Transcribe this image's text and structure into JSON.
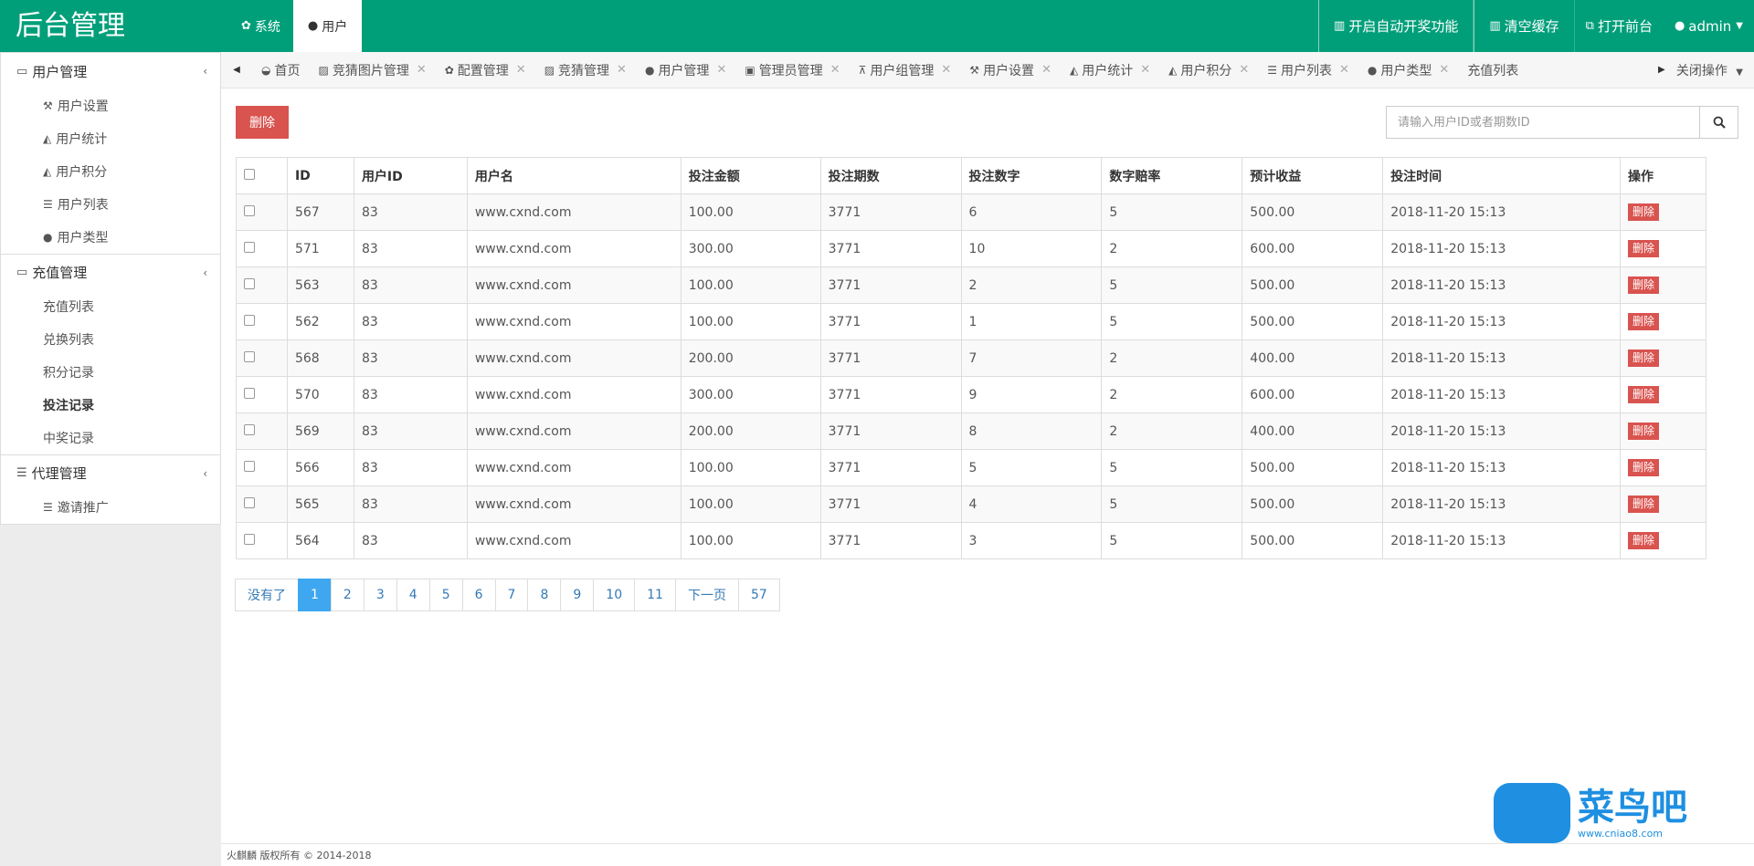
{
  "header": {
    "brand": "后台管理",
    "nav": [
      {
        "icon": "gear-icon",
        "glyph": "✿",
        "label": "系统"
      },
      {
        "icon": "user-icon",
        "glyph": "●",
        "label": "用户"
      }
    ],
    "actions": [
      {
        "icon": "trash-icon",
        "glyph": "▥",
        "label": "开启自动开奖功能"
      },
      {
        "icon": "trash-icon",
        "glyph": "▥",
        "label": "清空缓存"
      }
    ],
    "open_frontend": "打开前台",
    "user": "admin"
  },
  "sidebar": {
    "sections": [
      {
        "title": "用户管理",
        "items": [
          {
            "icon": "wrench-icon",
            "glyph": "⚒",
            "label": "用户设置"
          },
          {
            "icon": "area-chart-icon",
            "glyph": "◭",
            "label": "用户统计"
          },
          {
            "icon": "area-chart-icon",
            "glyph": "◭",
            "label": "用户积分"
          },
          {
            "icon": "list-icon",
            "glyph": "☰",
            "label": "用户列表"
          },
          {
            "icon": "user-icon",
            "glyph": "●",
            "label": "用户类型"
          }
        ]
      },
      {
        "title": "充值管理",
        "items": [
          {
            "label": "充值列表"
          },
          {
            "label": "兑换列表"
          },
          {
            "label": "积分记录"
          },
          {
            "label": "投注记录"
          },
          {
            "label": "中奖记录"
          }
        ]
      },
      {
        "title": "代理管理",
        "items": [
          {
            "icon": "list-icon",
            "glyph": "☰",
            "label": "邀请推广"
          }
        ]
      }
    ]
  },
  "tabs": [
    {
      "icon": "dashboard-icon",
      "glyph": "◒",
      "label": "首页"
    },
    {
      "icon": "image-icon",
      "glyph": "▨",
      "label": "竞猜图片管理"
    },
    {
      "icon": "cogs-icon",
      "glyph": "✿",
      "label": "配置管理"
    },
    {
      "icon": "image-icon",
      "glyph": "▨",
      "label": "竞猜管理"
    },
    {
      "icon": "user-icon",
      "glyph": "●",
      "label": "用户管理"
    },
    {
      "icon": "lock-icon",
      "glyph": "▣",
      "label": "管理员管理"
    },
    {
      "icon": "sitemap-icon",
      "glyph": "⊼",
      "label": "用户组管理"
    },
    {
      "icon": "wrench-icon",
      "glyph": "⚒",
      "label": "用户设置"
    },
    {
      "icon": "area-chart-icon",
      "glyph": "◭",
      "label": "用户统计"
    },
    {
      "icon": "area-chart-icon",
      "glyph": "◭",
      "label": "用户积分"
    },
    {
      "icon": "list-icon",
      "glyph": "☰",
      "label": "用户列表"
    },
    {
      "icon": "user-icon",
      "glyph": "●",
      "label": "用户类型"
    },
    {
      "label": "充值列表"
    }
  ],
  "tab_close_ops": "关闭操作",
  "content": {
    "delete_label": "删除",
    "search_placeholder": "请输入用户ID或者期数ID",
    "columns": [
      "ID",
      "用户ID",
      "用户名",
      "投注金额",
      "投注期数",
      "投注数字",
      "数字赔率",
      "预计收益",
      "投注时间",
      "操作"
    ],
    "row_action": "删除",
    "rows": [
      [
        "567",
        "83",
        "www.cxnd.com",
        "100.00",
        "3771",
        "6",
        "5",
        "500.00",
        "2018-11-20 15:13"
      ],
      [
        "571",
        "83",
        "www.cxnd.com",
        "300.00",
        "3771",
        "10",
        "2",
        "600.00",
        "2018-11-20 15:13"
      ],
      [
        "563",
        "83",
        "www.cxnd.com",
        "100.00",
        "3771",
        "2",
        "5",
        "500.00",
        "2018-11-20 15:13"
      ],
      [
        "562",
        "83",
        "www.cxnd.com",
        "100.00",
        "3771",
        "1",
        "5",
        "500.00",
        "2018-11-20 15:13"
      ],
      [
        "568",
        "83",
        "www.cxnd.com",
        "200.00",
        "3771",
        "7",
        "2",
        "400.00",
        "2018-11-20 15:13"
      ],
      [
        "570",
        "83",
        "www.cxnd.com",
        "300.00",
        "3771",
        "9",
        "2",
        "600.00",
        "2018-11-20 15:13"
      ],
      [
        "569",
        "83",
        "www.cxnd.com",
        "200.00",
        "3771",
        "8",
        "2",
        "400.00",
        "2018-11-20 15:13"
      ],
      [
        "566",
        "83",
        "www.cxnd.com",
        "100.00",
        "3771",
        "5",
        "5",
        "500.00",
        "2018-11-20 15:13"
      ],
      [
        "565",
        "83",
        "www.cxnd.com",
        "100.00",
        "3771",
        "4",
        "5",
        "500.00",
        "2018-11-20 15:13"
      ],
      [
        "564",
        "83",
        "www.cxnd.com",
        "100.00",
        "3771",
        "3",
        "5",
        "500.00",
        "2018-11-20 15:13"
      ]
    ],
    "pagination": [
      "没有了",
      "1",
      "2",
      "3",
      "4",
      "5",
      "6",
      "7",
      "8",
      "9",
      "10",
      "11",
      "下一页",
      "57"
    ],
    "active_page": "1"
  },
  "footer": "火麒麟 版权所有 © 2014-2018",
  "corner_logo": {
    "title": "菜鸟吧",
    "url": "www.cniao8.com"
  },
  "colors": {
    "brand": "#009f7a",
    "danger": "#d9534f",
    "active_page": "#3ea7f0"
  }
}
